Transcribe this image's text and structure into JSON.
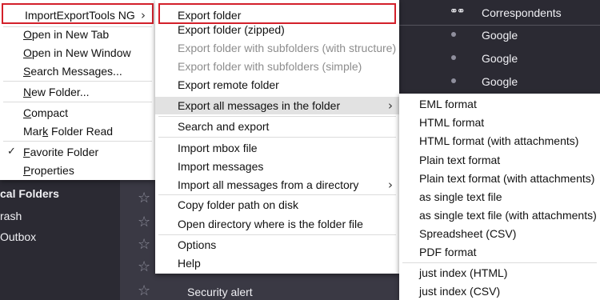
{
  "folder_pane": {
    "section_label": "cal Folders",
    "items": [
      "rash",
      "Outbox"
    ]
  },
  "header": {
    "thread_icon": "glasses-icon",
    "correspondents_label": "Correspondents"
  },
  "messages": {
    "senders": [
      "Google",
      "Google",
      "Google"
    ],
    "security_alert": "Security alert"
  },
  "context_menu": {
    "top_item": "ImportExportTools NG",
    "items": [
      {
        "pre": "",
        "u": "O",
        "post": "pen in New Tab"
      },
      {
        "pre": "",
        "u": "O",
        "post": "pen in New Window"
      },
      {
        "pre": "",
        "u": "S",
        "post": "earch Messages..."
      },
      {
        "pre": "",
        "u": "N",
        "post": "ew Folder..."
      },
      {
        "pre": "",
        "u": "C",
        "post": "ompact"
      },
      {
        "pre": "Mar",
        "u": "k",
        "post": " Folder Read"
      },
      {
        "pre": "",
        "u": "F",
        "post": "avorite Folder"
      },
      {
        "pre": "",
        "u": "P",
        "post": "roperties"
      }
    ],
    "check_mark": "✓"
  },
  "export_submenu": {
    "top_item": "Export folder",
    "items": [
      "Export folder (zipped)",
      "Export folder with subfolders (with structure)",
      "Export folder with subfolders (simple)",
      "Export remote folder",
      "Export all messages in the folder",
      "Search and export",
      "Import mbox file",
      "Import messages",
      "Import all messages from a directory",
      "Copy folder path on disk",
      "Open directory where is the folder file",
      "Options",
      "Help"
    ]
  },
  "format_submenu": {
    "items": [
      "EML format",
      "HTML format",
      "HTML format (with attachments)",
      "Plain text format",
      "Plain text format (with attachments)",
      "as single text file",
      "as single text file (with attachments)",
      "Spreadsheet (CSV)",
      "PDF format",
      "just index (HTML)",
      "just index (CSV)"
    ]
  },
  "colors": {
    "highlight_border": "#d3202a",
    "menu_bg": "#ffffff",
    "app_bg": "#2b2a33"
  }
}
